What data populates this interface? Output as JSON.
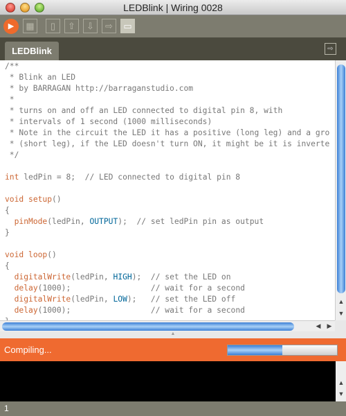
{
  "window": {
    "title": "LEDBlink | Wiring 0028"
  },
  "toolbar": {
    "icons": [
      "run-icon",
      "stop-icon",
      "new-icon",
      "open-icon",
      "save-icon",
      "upload-icon",
      "serial-monitor-icon"
    ],
    "accent": "#ef6a2b"
  },
  "tabs": [
    {
      "label": "LEDBlink"
    }
  ],
  "editor": {
    "lines": [
      "/**",
      " * Blink an LED",
      " * by BARRAGAN http://barraganstudio.com",
      " *",
      " * turns on and off an LED connected to digital pin 8, with",
      " * intervals of 1 second (1000 milliseconds)",
      " * Note in the circuit the LED it has a positive (long leg) and a gro",
      " * (short leg), if the LED doesn't turn ON, it might be it is inverte",
      " */",
      "",
      "int ledPin = 8;  // LED connected to digital pin 8",
      "",
      "void setup()",
      "{",
      "  pinMode(ledPin, OUTPUT);  // set ledPin pin as output",
      "}",
      "",
      "void loop()",
      "{",
      "  digitalWrite(ledPin, HIGH);  // set the LED on",
      "  delay(1000);                 // wait for a second",
      "  digitalWrite(ledPin, LOW);   // set the LED off",
      "  delay(1000);                 // wait for a second",
      "}"
    ]
  },
  "status": {
    "message": "Compiling...",
    "progress_percent": 50,
    "color": "#ef6a30"
  },
  "footer": {
    "line_number": "1"
  }
}
